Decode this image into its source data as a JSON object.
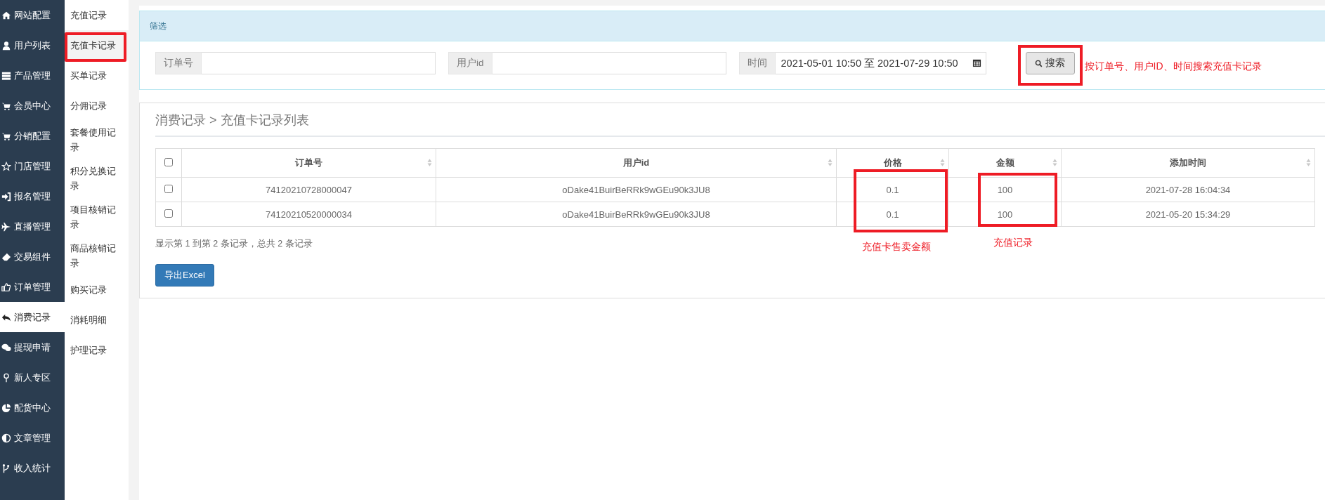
{
  "sidebar": {
    "items": [
      {
        "label": "网站配置",
        "selected": false
      },
      {
        "label": "用户列表",
        "selected": false
      },
      {
        "label": "产品管理",
        "selected": false
      },
      {
        "label": "会员中心",
        "selected": false
      },
      {
        "label": "分销配置",
        "selected": false
      },
      {
        "label": "门店管理",
        "selected": false
      },
      {
        "label": "报名管理",
        "selected": false
      },
      {
        "label": "直播管理",
        "selected": false
      },
      {
        "label": "交易组件",
        "selected": false
      },
      {
        "label": "订单管理",
        "selected": false
      },
      {
        "label": "消费记录",
        "selected": true
      },
      {
        "label": "提现申请",
        "selected": false
      },
      {
        "label": "新人专区",
        "selected": false
      },
      {
        "label": "配货中心",
        "selected": false
      },
      {
        "label": "文章管理",
        "selected": false
      },
      {
        "label": "收入统计",
        "selected": false
      }
    ]
  },
  "submenu": {
    "items": [
      {
        "label": "充值记录",
        "selected": false
      },
      {
        "label": "充值卡记录",
        "selected": true
      },
      {
        "label": "买单记录",
        "selected": false
      },
      {
        "label": "分佣记录",
        "selected": false
      },
      {
        "label": "套餐使用记录",
        "selected": false
      },
      {
        "label": "积分兑换记录",
        "selected": false
      },
      {
        "label": "项目核销记录",
        "selected": false
      },
      {
        "label": "商品核销记录",
        "selected": false
      },
      {
        "label": "购买记录",
        "selected": false
      },
      {
        "label": "消耗明细",
        "selected": false
      },
      {
        "label": "护理记录",
        "selected": false
      }
    ]
  },
  "filter": {
    "title": "筛选",
    "fields": [
      {
        "label": "订单号"
      },
      {
        "label": "用户id"
      },
      {
        "label": "时间",
        "value": "2021-05-01 10:50 至 2021-07-29 10:50"
      }
    ],
    "search_button": "搜索"
  },
  "list": {
    "breadcrumb": "消费记录 > 充值卡记录列表",
    "table": {
      "columns": [
        {
          "label": "订单号"
        },
        {
          "label": "用户id"
        },
        {
          "label": "价格"
        },
        {
          "label": "金额"
        },
        {
          "label": "添加时间"
        }
      ],
      "header_checked": false,
      "rows": [
        {
          "checked": false,
          "cells": [
            "74120210728000047",
            "oDake41BuirBeRRk9wGEu90k3JU8",
            "0.1",
            "100",
            "2021-07-28 16:04:34"
          ]
        },
        {
          "checked": false,
          "cells": [
            "74120210520000034",
            "oDake41BuirBeRRk9wGEu90k3JU8",
            "0.1",
            "100",
            "2021-05-20 15:34:29"
          ]
        }
      ]
    },
    "pagination": "显示第 1 到第 2 条记录，总共 2 条记录",
    "export_button": "导出Excel"
  },
  "annotations": {
    "search": "按订单号、用户ID、时间搜索充值卡记录",
    "price": "充值卡售卖金额",
    "amount": "充值记录"
  }
}
